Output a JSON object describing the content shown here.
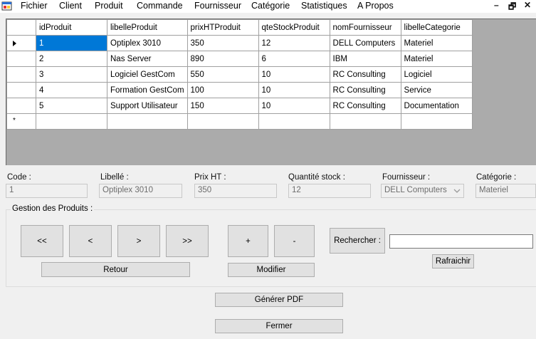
{
  "menubar": {
    "icon": "app-window-icon",
    "items": [
      "Fichier",
      "Client",
      "Produit",
      "Commande",
      "Fournisseur",
      "Catégorie",
      "Statistiques",
      "A Propos"
    ],
    "window_controls": [
      "–",
      "🗗",
      "✕"
    ]
  },
  "grid": {
    "columns": [
      "idProduit",
      "libelleProduit",
      "prixHTProduit",
      "qteStockProduit",
      "nomFournisseur",
      "libelleCategorie"
    ],
    "rows": [
      [
        "1",
        "Optiplex 3010",
        "350",
        "12",
        "DELL Computers",
        "Materiel"
      ],
      [
        "2",
        "Nas Server",
        "890",
        "6",
        "IBM",
        "Materiel"
      ],
      [
        "3",
        "Logiciel GestCom",
        "550",
        "10",
        "RC Consulting",
        "Logiciel"
      ],
      [
        "4",
        "Formation GestCom",
        "100",
        "10",
        "RC Consulting",
        "Service"
      ],
      [
        "5",
        "Support Utilisateur",
        "150",
        "10",
        "RC Consulting",
        "Documentation"
      ]
    ],
    "new_row_marker": "*",
    "selected_row": 0
  },
  "fields": {
    "code": {
      "label": "Code :",
      "value": "1"
    },
    "libelle": {
      "label": "Libellé :",
      "value": "Optiplex 3010"
    },
    "prix": {
      "label": "Prix HT :",
      "value": "350"
    },
    "quantite": {
      "label": "Quantité stock :",
      "value": "12"
    },
    "fournisseur": {
      "label": "Fournisseur :",
      "value": "DELL Computers"
    },
    "categorie": {
      "label": "Catégorie :",
      "value": "Materiel"
    }
  },
  "group": {
    "title": "Gestion des Produits :",
    "first": "<<",
    "prev": "<",
    "next": ">",
    "last": ">>",
    "add": "+",
    "remove": "-",
    "back": "Retour",
    "modify": "Modifier",
    "search": "Rechercher :",
    "search_value": "",
    "refresh": "Rafraichir"
  },
  "bottom": {
    "pdf": "Générer PDF",
    "close": "Fermer"
  },
  "colors": {
    "selection": "#0078d7",
    "grid_background": "#ababab",
    "form_background": "#f0f0f0",
    "button_face": "#e1e1e1"
  }
}
